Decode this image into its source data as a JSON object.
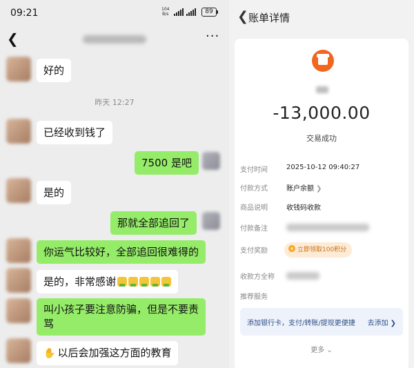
{
  "status_bar": {
    "time": "09:21",
    "net_speed": "104",
    "net_unit": "B/s",
    "battery": "89"
  },
  "chat": {
    "timestamp": "昨天 12:27",
    "messages": [
      {
        "side": "in",
        "text": "好的"
      },
      {
        "side": "in",
        "text": "已经收到钱了"
      },
      {
        "side": "out",
        "text": "7500 是吧"
      },
      {
        "side": "in",
        "text": "是的"
      },
      {
        "side": "out",
        "text": "那就全部追回了"
      },
      {
        "side": "in",
        "text": "你运气比较好，全部追回很难得的"
      },
      {
        "side": "in",
        "text": "是的，非常感谢"
      },
      {
        "side": "in",
        "text_line1": "叫小孩子要注意防骗，但是不要责",
        "text_line2": "骂"
      },
      {
        "side": "in",
        "text": "以后会加强这方面的教育"
      }
    ]
  },
  "bill": {
    "title": "账单详情",
    "amount": "-13,000.00",
    "status": "交易成功",
    "rows": {
      "pay_time": {
        "label": "支付时间",
        "value": "2025-10-12 09:40:27"
      },
      "pay_method": {
        "label": "付款方式",
        "value": "账户余额"
      },
      "product": {
        "label": "商品说明",
        "value": "收钱码收款"
      },
      "note": {
        "label": "付款备注"
      },
      "reward": {
        "label": "支付奖励",
        "value": "立即领取100积分"
      },
      "payee": {
        "label": "收款方全称"
      },
      "recommend": {
        "label": "推荐服务"
      }
    },
    "bank_banner": {
      "text": "添加银行卡，支付/转账/提现更便捷",
      "link": "去添加"
    },
    "more": "更多"
  },
  "colors": {
    "bubble_out": "#95ec69",
    "bubble_in": "#ffffff",
    "chat_bg": "#ededed",
    "shop_icon": "#f0671f",
    "reward_text": "#c77016"
  }
}
